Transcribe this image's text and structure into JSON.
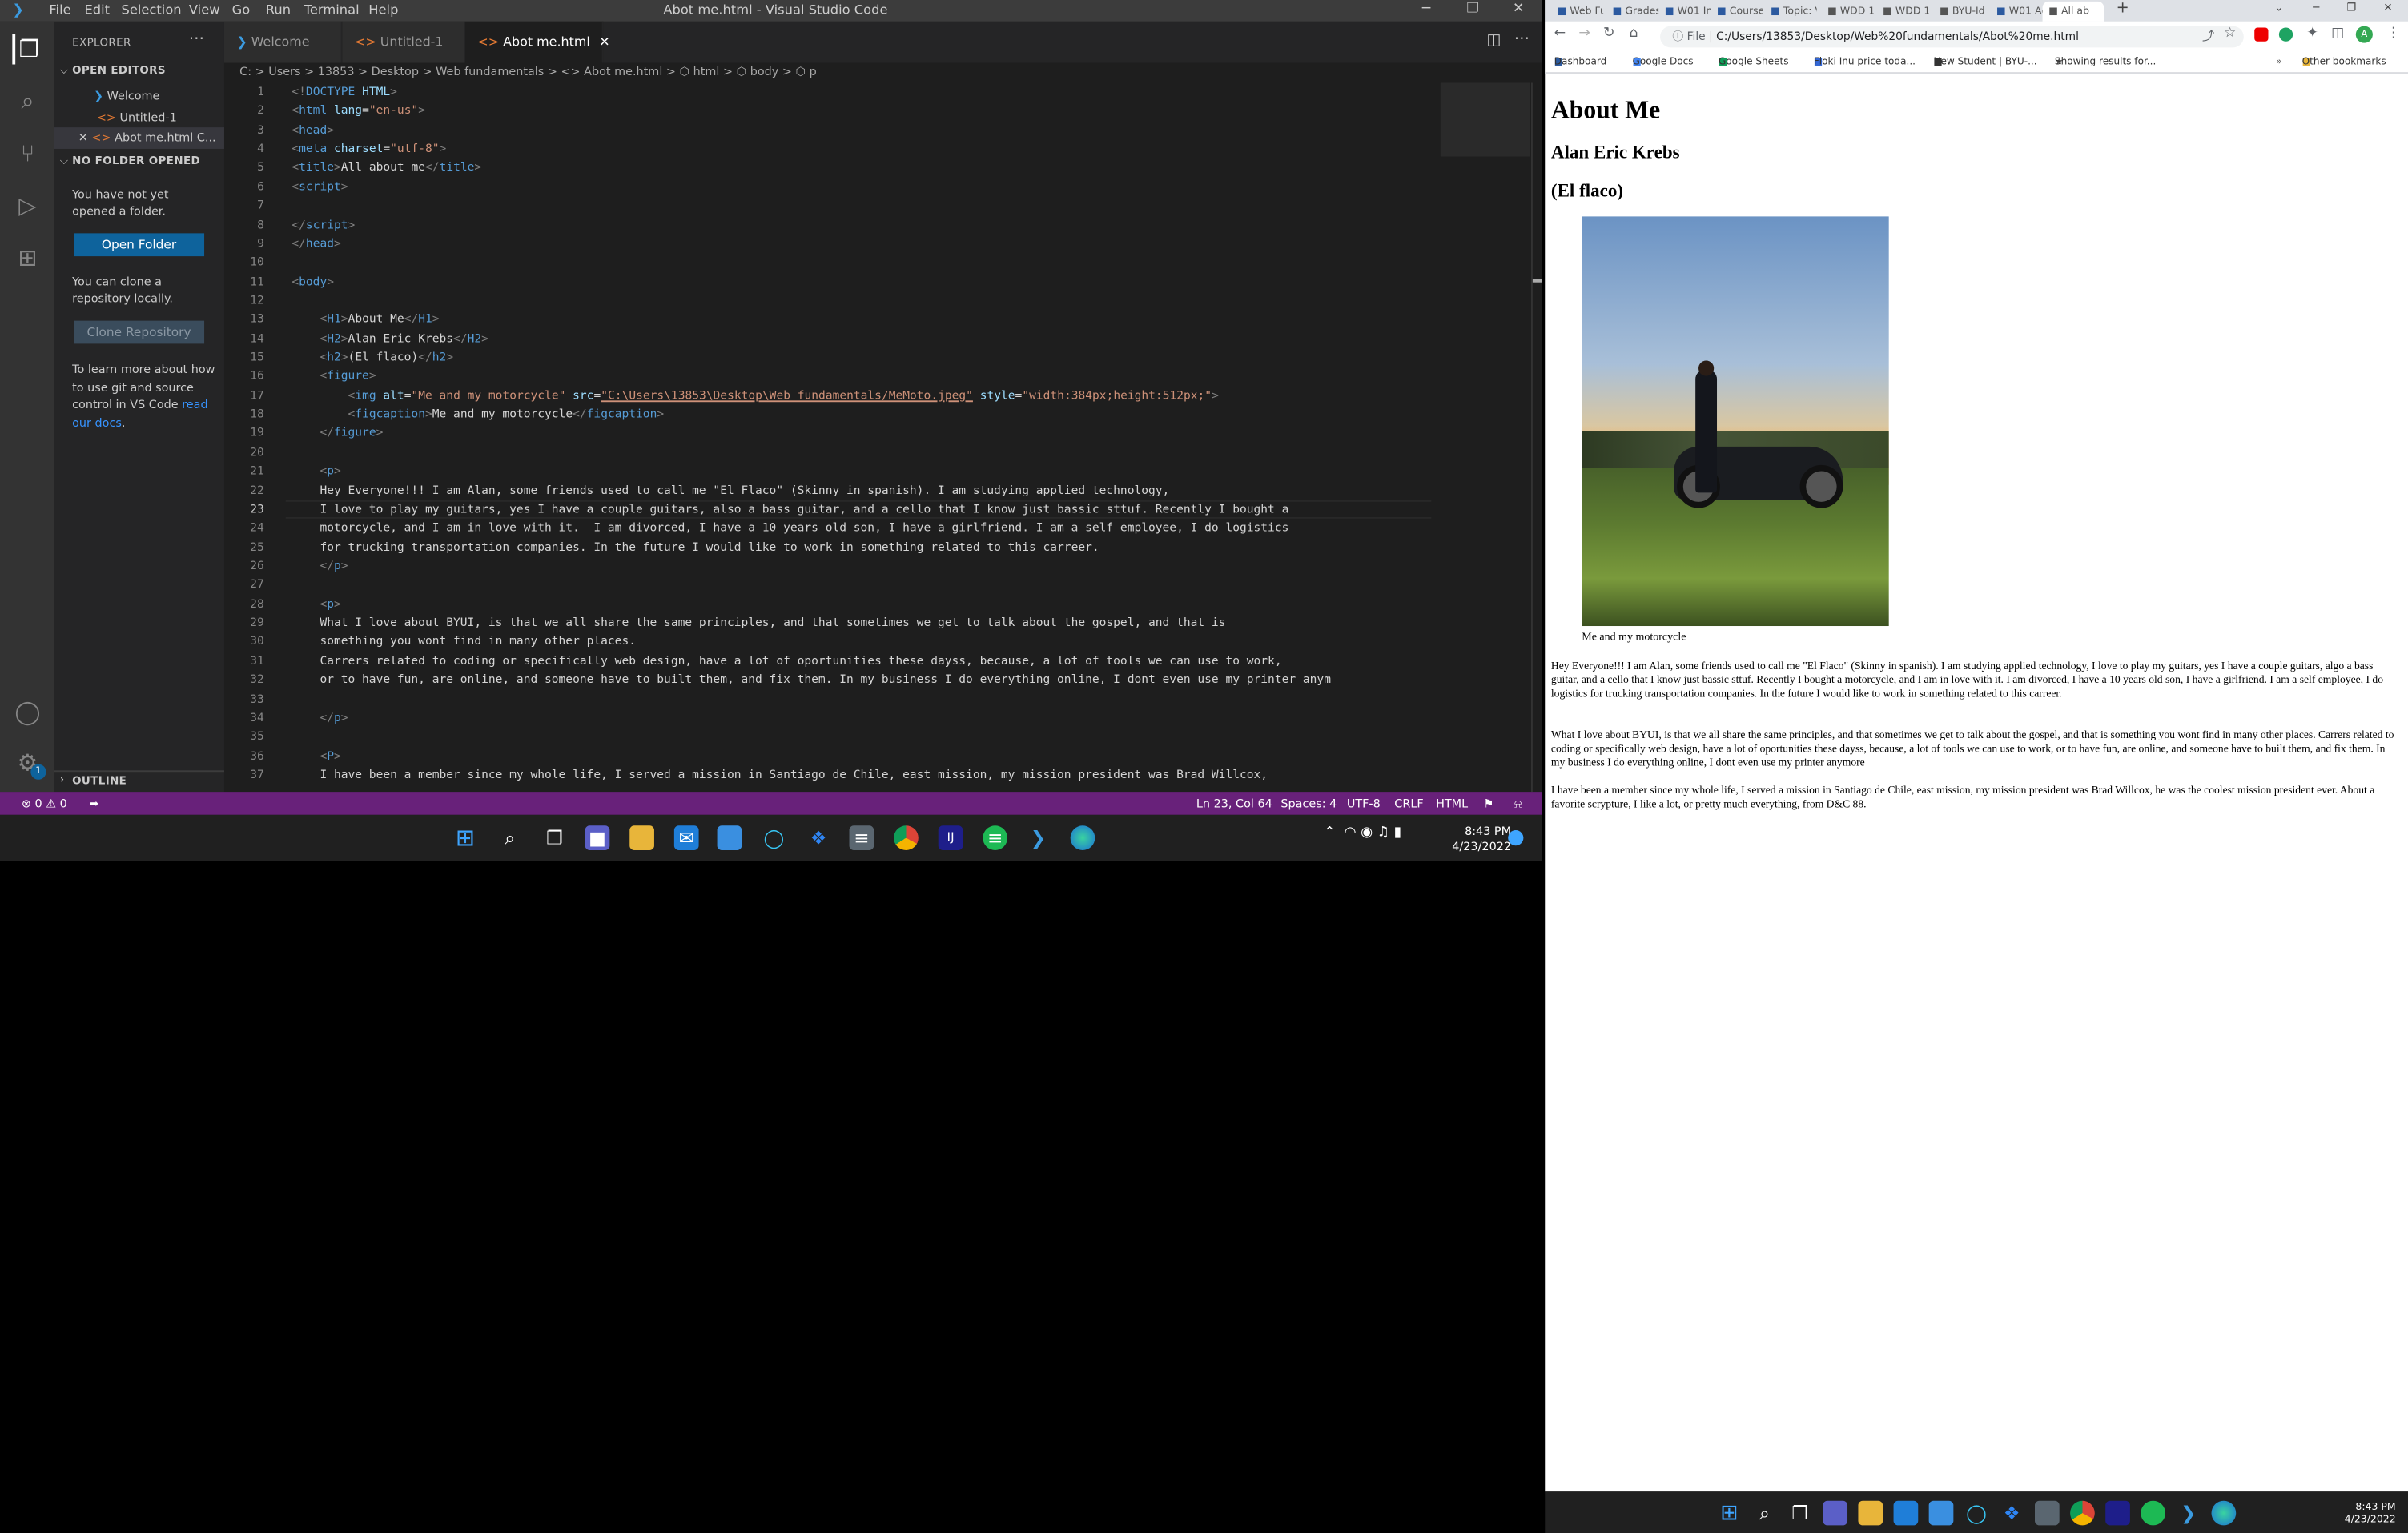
{
  "vscode": {
    "menu": [
      "File",
      "Edit",
      "Selection",
      "View",
      "Go",
      "Run",
      "Terminal",
      "Help"
    ],
    "window_title": "Abot me.html - Visual Studio Code",
    "sidebar": {
      "explorer_title": "EXPLORER",
      "open_editors_title": "OPEN EDITORS",
      "open_editors": [
        "Welcome",
        "Untitled-1",
        "Abot me.html C..."
      ],
      "no_folder_title": "NO FOLDER OPENED",
      "no_folder_msg": "You have not yet opened a folder.",
      "open_folder_btn": "Open Folder",
      "clone_msg": "You can clone a repository locally.",
      "clone_btn": "Clone Repository",
      "learn_msg": "To learn more about how to use git and source control in VS Code ",
      "learn_link": "read our docs",
      "learn_end": ".",
      "outline_title": "OUTLINE"
    },
    "tabs": [
      "Welcome",
      "Untitled-1",
      "Abot me.html"
    ],
    "breadcrumb": "C: > Users > 13853 > Desktop > Web fundamentals > <> Abot me.html > ⬡ html > ⬡ body > ⬡ p",
    "line_numbers": [
      "1",
      "2",
      "3",
      "4",
      "5",
      "6",
      "7",
      "8",
      "9",
      "10",
      "11",
      "12",
      "13",
      "14",
      "15",
      "16",
      "17",
      "18",
      "19",
      "20",
      "21",
      "22",
      "23",
      "24",
      "25",
      "26",
      "27",
      "28",
      "29",
      "30",
      "31",
      "32",
      "33",
      "34",
      "35",
      "36",
      "37"
    ],
    "code_lines": [
      [
        [
          "<!",
          "br"
        ],
        [
          "DOCTYPE",
          "tg"
        ],
        [
          " HTML",
          "at"
        ],
        [
          ">",
          "br"
        ]
      ],
      [
        [
          "<",
          "br"
        ],
        [
          "html",
          "tg"
        ],
        [
          " lang",
          "at"
        ],
        [
          "=",
          "tx"
        ],
        [
          "\"en-us\"",
          "sv"
        ],
        [
          ">",
          "br"
        ]
      ],
      [
        [
          "<",
          "br"
        ],
        [
          "head",
          "tg"
        ],
        [
          ">",
          "br"
        ]
      ],
      [
        [
          "<",
          "br"
        ],
        [
          "meta",
          "tg"
        ],
        [
          " charset",
          "at"
        ],
        [
          "=",
          "tx"
        ],
        [
          "\"utf-8\"",
          "sv"
        ],
        [
          ">",
          "br"
        ]
      ],
      [
        [
          "<",
          "br"
        ],
        [
          "title",
          "tg"
        ],
        [
          ">",
          "br"
        ],
        [
          "All about me",
          "tx"
        ],
        [
          "</",
          "br"
        ],
        [
          "title",
          "tg"
        ],
        [
          ">",
          "br"
        ]
      ],
      [
        [
          "<",
          "br"
        ],
        [
          "script",
          "tg"
        ],
        [
          ">",
          "br"
        ]
      ],
      [],
      [
        [
          "</",
          "br"
        ],
        [
          "script",
          "tg"
        ],
        [
          ">",
          "br"
        ]
      ],
      [
        [
          "</",
          "br"
        ],
        [
          "head",
          "tg"
        ],
        [
          ">",
          "br"
        ]
      ],
      [],
      [
        [
          "<",
          "br"
        ],
        [
          "body",
          "tg"
        ],
        [
          ">",
          "br"
        ]
      ],
      [],
      [
        [
          "    <",
          "br"
        ],
        [
          "H1",
          "tg"
        ],
        [
          ">",
          "br"
        ],
        [
          "About Me",
          "tx"
        ],
        [
          "</",
          "br"
        ],
        [
          "H1",
          "tg"
        ],
        [
          ">",
          "br"
        ]
      ],
      [
        [
          "    <",
          "br"
        ],
        [
          "H2",
          "tg"
        ],
        [
          ">",
          "br"
        ],
        [
          "Alan Eric Krebs",
          "tx"
        ],
        [
          "</",
          "br"
        ],
        [
          "H2",
          "tg"
        ],
        [
          ">",
          "br"
        ]
      ],
      [
        [
          "    <",
          "br"
        ],
        [
          "h2",
          "tg"
        ],
        [
          ">",
          "br"
        ],
        [
          "(El flaco)",
          "tx"
        ],
        [
          "</",
          "br"
        ],
        [
          "h2",
          "tg"
        ],
        [
          ">",
          "br"
        ]
      ],
      [
        [
          "    <",
          "br"
        ],
        [
          "figure",
          "tg"
        ],
        [
          ">",
          "br"
        ]
      ],
      [
        [
          "        <",
          "br"
        ],
        [
          "img",
          "tg"
        ],
        [
          " alt",
          "at"
        ],
        [
          "=",
          "tx"
        ],
        [
          "\"Me and my motorcycle\"",
          "sv"
        ],
        [
          " src",
          "at"
        ],
        [
          "=",
          "tx"
        ],
        [
          "\"C:\\Users\\13853\\Desktop\\Web fundamentals/MeMoto.jpeg\"",
          "sv"
        ],
        [
          " style",
          "at"
        ],
        [
          "=",
          "tx"
        ],
        [
          "\"width:384px;height:512px;\"",
          "sv"
        ],
        [
          ">",
          "br"
        ]
      ],
      [
        [
          "        <",
          "br"
        ],
        [
          "figcaption",
          "tg"
        ],
        [
          ">",
          "br"
        ],
        [
          "Me and my motorcycle",
          "tx"
        ],
        [
          "</",
          "br"
        ],
        [
          "figcaption",
          "tg"
        ],
        [
          ">",
          "br"
        ]
      ],
      [
        [
          "    </",
          "br"
        ],
        [
          "figure",
          "tg"
        ],
        [
          ">",
          "br"
        ]
      ],
      [],
      [
        [
          "    <",
          "br"
        ],
        [
          "p",
          "tg"
        ],
        [
          ">",
          "br"
        ]
      ],
      [
        [
          "    Hey Everyone!!! I am Alan, some friends used to call me \"El Flaco\" (Skinny in spanish). I am studying applied technology,",
          "tx"
        ]
      ],
      [
        [
          "    I love to play my guitars, yes I have a couple guitars, also a bass guitar, and a cello that I know just bassic sttuf. Recently I bought a",
          "tx"
        ]
      ],
      [
        [
          "    motorcycle, and I am in love with it.  I am divorced, I have a 10 years old son, I have a girlfriend. I am a self employee, I do logistics",
          "tx"
        ]
      ],
      [
        [
          "    for trucking transportation companies. In the future I would like to work in something related to this carreer.",
          "tx"
        ]
      ],
      [
        [
          "    </",
          "br"
        ],
        [
          "p",
          "tg"
        ],
        [
          ">",
          "br"
        ]
      ],
      [],
      [
        [
          "    <",
          "br"
        ],
        [
          "p",
          "tg"
        ],
        [
          ">",
          "br"
        ]
      ],
      [
        [
          "    What I love about BYUI, is that we all share the same principles, and that sometimes we get to talk about the gospel, and that is",
          "tx"
        ]
      ],
      [
        [
          "    something you wont find in many other places.",
          "tx"
        ]
      ],
      [
        [
          "    Carrers related to coding or specifically web design, have a lot of oportunities these dayss, because, a lot of tools we can use to work,",
          "tx"
        ]
      ],
      [
        [
          "    or to have fun, are online, and someone have to built them, and fix them. In my business I do everything online, I dont even use my printer anym",
          "tx"
        ]
      ],
      [],
      [
        [
          "    </",
          "br"
        ],
        [
          "p",
          "tg"
        ],
        [
          ">",
          "br"
        ]
      ],
      [],
      [
        [
          "    <",
          "br"
        ],
        [
          "P",
          "tg"
        ],
        [
          ">",
          "br"
        ]
      ],
      [
        [
          "    I have been a member since my whole life, I served a mission in Santiago de Chile, east mission, my mission president was Brad Willcox,",
          "tx"
        ]
      ]
    ],
    "status": {
      "problems": "⊗ 0 ⚠ 0",
      "position": "Ln 23, Col 64",
      "spaces": "Spaces: 4",
      "encoding": "UTF-8",
      "eol": "CRLF",
      "language": "HTML"
    }
  },
  "taskbar": {
    "time": "8:43 PM",
    "date": "4/23/2022"
  },
  "browser": {
    "tabs": [
      "Web Fu",
      "Grades",
      "W01 In",
      "Course",
      "Topic: V",
      "WDD 1",
      "WDD 1",
      "BYU-Id",
      "W01 Ad",
      "All ab"
    ],
    "url": "C:/Users/13853/Desktop/Web%20fundamentals/Abot%20me.html",
    "url_prefix": "File",
    "bookmarks": [
      "Dashboard",
      "Google Docs",
      "Google Sheets",
      "Floki Inu price toda...",
      "New Student | BYU-...",
      "Showing results for...",
      "Other bookmarks"
    ],
    "h1": "About Me",
    "h2a": "Alan Eric Krebs",
    "h2b": "(El flaco)",
    "figcaption": "Me and my motorcycle",
    "p1": "Hey Everyone!!! I am Alan, some friends used to call me \"El Flaco\" (Skinny in spanish). I am studying applied technology, I love to play my guitars, yes I have a couple guitars, algo a bass guitar, and a cello that I know just bassic sttuf. Recently I bought a motorcycle, and I am in love with it. I am divorced, I have a 10 years old son, I have a girlfriend. I am a self employee, I do logistics for trucking transportation companies. In the future I would like to work in something related to this carreer.",
    "p2": "What I love about BYUI, is that we all share the same principles, and that sometimes we get to talk about the gospel, and that is something you wont find in many other places. Carrers related to coding or specifically web design, have a lot of oportunities these dayss, because, a lot of tools we can use to work, or to have fun, are online, and someone have to built them, and fix them. In my business I do everything online, I dont even use my printer anymore",
    "p3": "I have been a member since my whole life, I served a mission in Santiago de Chile, east mission, my mission president was Brad Willcox, he was the coolest mission president ever. About a favorite scrypture, I like a lot, or pretty much everything, from D&C 88."
  },
  "icons": [
    "vscode-icon",
    "files-icon",
    "search-icon",
    "source-control-icon",
    "run-debug-icon",
    "extensions-icon",
    "account-icon",
    "gear-icon",
    "windows-start-icon",
    "edge-icon",
    "spotify-icon",
    "chrome-icon",
    "folder-icon",
    "mail-icon",
    "dropbox-icon",
    "calculator-icon"
  ],
  "colors": {
    "statusbar": "#68217a",
    "editor_bg": "#1e1e1e",
    "button": "#0e639c",
    "tag": "#569cd6",
    "attr": "#9cdcfe",
    "string": "#ce9178"
  }
}
